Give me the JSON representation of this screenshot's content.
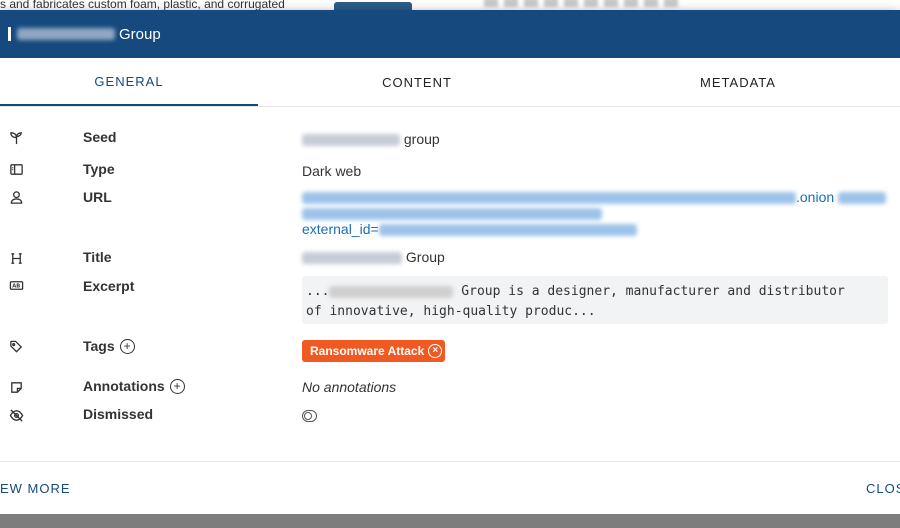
{
  "background": {
    "text": "s and fabricates custom foam, plastic, and corrugated"
  },
  "modal": {
    "title_suffix": "Group",
    "tabs": [
      "GENERAL",
      "CONTENT",
      "METADATA"
    ],
    "fields": {
      "seed": {
        "label": "Seed",
        "value_suffix": "group"
      },
      "type": {
        "label": "Type",
        "value": "Dark web"
      },
      "url": {
        "label": "URL",
        "line1_suffix": ".onion",
        "line3_prefix": "external_id="
      },
      "title": {
        "label": "Title",
        "value_suffix": "Group"
      },
      "excerpt": {
        "label": "Excerpt",
        "line1_prefix": "...",
        "line1_suffix": " Group is a designer, manufacturer and distributor",
        "line2": "of innovative, high-quality produc..."
      },
      "tags": {
        "label": "Tags",
        "items": [
          "Ransomware Attack"
        ]
      },
      "annotations": {
        "label": "Annotations",
        "value": "No annotations"
      },
      "dismissed": {
        "label": "Dismissed",
        "value": false
      }
    },
    "footer": {
      "view_more": "EW MORE",
      "close": "CLOS"
    }
  },
  "colors": {
    "header": "#164a7e",
    "tag": "#f05a22",
    "link": "#1a6fb3"
  },
  "icons": {
    "seed": "sprout-icon",
    "type": "sidebar-panel-icon",
    "url": "user-icon",
    "title": "heading-icon",
    "excerpt": "ab-box-icon",
    "tags": "tags-icon",
    "annotations": "sticky-note-icon",
    "dismissed": "eye-off-icon"
  }
}
